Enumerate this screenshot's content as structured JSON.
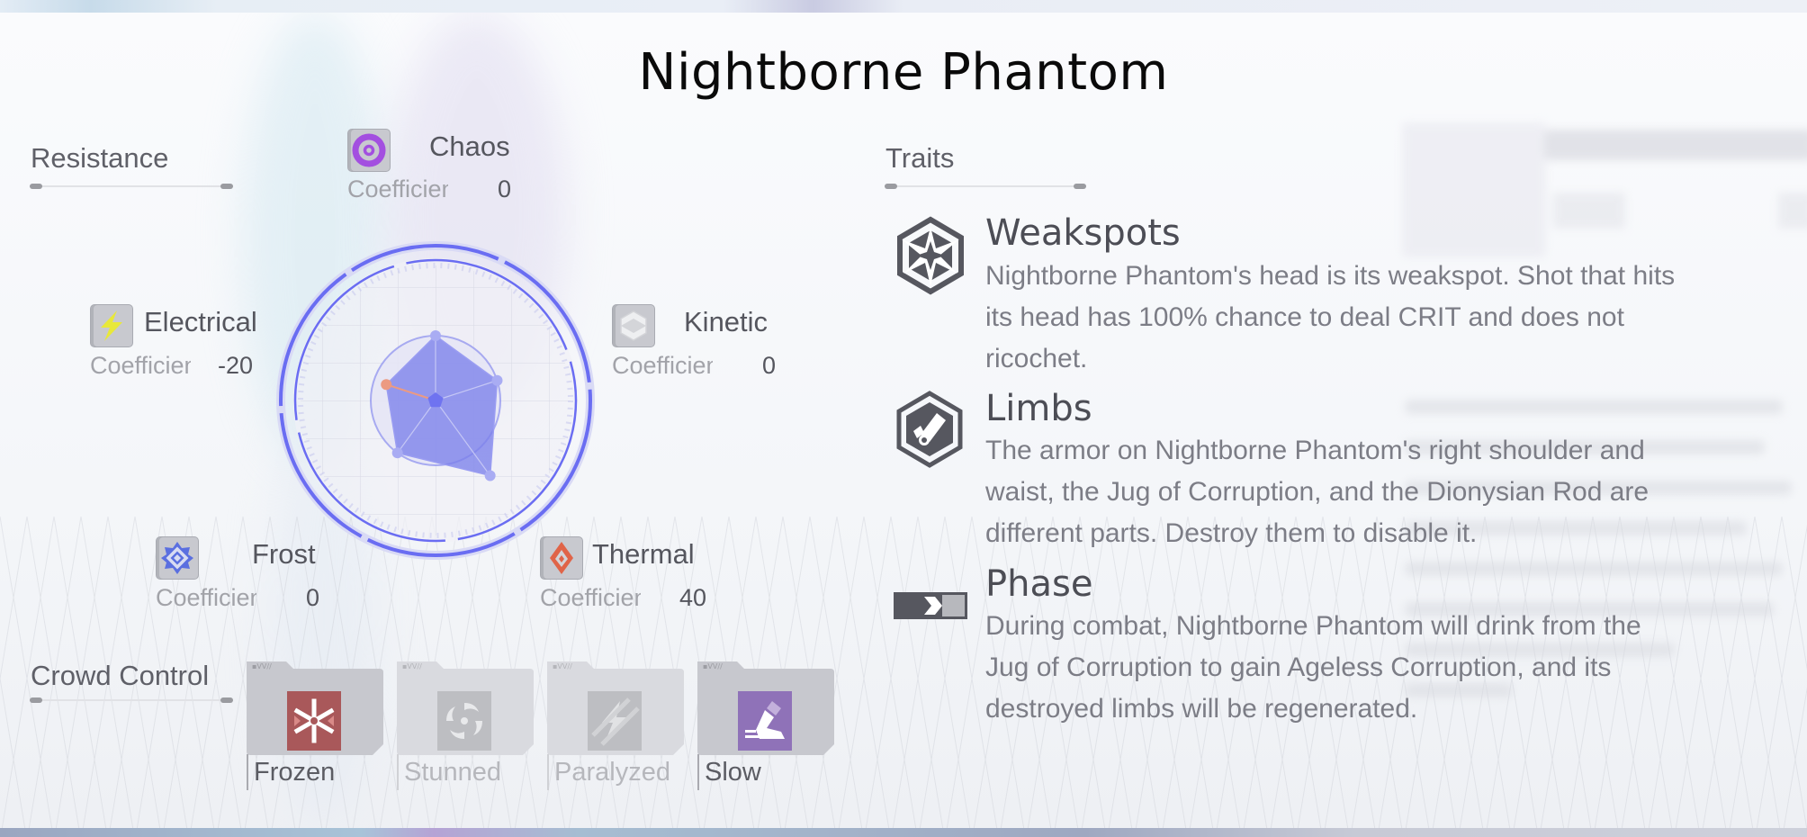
{
  "title": "Nightborne Phantom",
  "resistance": {
    "heading": "Resistance",
    "coefficient_label": "Coefficient",
    "elements": [
      {
        "name": "Chaos",
        "value": "0",
        "icon": "chaos-ring-icon",
        "color": "#a34fe0"
      },
      {
        "name": "Electrical",
        "value": "-20",
        "icon": "lightning-bolt-icon",
        "color": "#e8e83a"
      },
      {
        "name": "Kinetic",
        "value": "0",
        "icon": "kinetic-cube-icon",
        "color": "#e9eaec"
      },
      {
        "name": "Frost",
        "value": "0",
        "icon": "frost-star-icon",
        "color": "#5a6fe0"
      },
      {
        "name": "Thermal",
        "value": "40",
        "icon": "thermal-flame-icon",
        "color": "#e06448"
      }
    ],
    "radar": {
      "axes": [
        "Chaos",
        "Kinetic",
        "Thermal",
        "Frost",
        "Electrical"
      ],
      "values": [
        0,
        0,
        40,
        0,
        -20
      ],
      "range": [
        -100,
        100
      ],
      "fill_color": "#7b80ea",
      "ring_color": "#6a6df2",
      "negative_point_color": "#ec9a82"
    }
  },
  "traits": {
    "heading": "Traits",
    "items": [
      {
        "title": "Weakspots",
        "icon": "weakspot-star-hexagon-icon",
        "lines": [
          "Nightborne Phantom's head is its weakspot. Shot that hits",
          "its head has 100% chance to deal CRIT and does not",
          "ricochet."
        ]
      },
      {
        "title": "Limbs",
        "icon": "limbs-hexagon-icon",
        "lines": [
          "The armor on Nightborne Phantom's right shoulder and",
          "waist, the Jug of Corruption, and the Dionysian Rod are",
          "different parts. Destroy them to disable it."
        ]
      },
      {
        "title": "Phase",
        "icon": "phase-arrow-icon",
        "lines": [
          "During combat, Nightborne Phantom will drink from the",
          "Jug of Corruption to gain Ageless Corruption, and its",
          "destroyed limbs will be regenerated."
        ]
      }
    ]
  },
  "crowd_control": {
    "heading": "Crowd Control",
    "items": [
      {
        "label": "Frozen",
        "active": true,
        "icon": "frozen-snowflake-icon",
        "color": "#a9585a"
      },
      {
        "label": "Stunned",
        "active": false,
        "icon": "stunned-swirl-icon",
        "color": "#b8b9bd"
      },
      {
        "label": "Paralyzed",
        "active": false,
        "icon": "paralyzed-bolt-icon",
        "color": "#b8b9bd"
      },
      {
        "label": "Slow",
        "active": true,
        "icon": "slow-foot-icon",
        "color": "#8f72b8"
      }
    ]
  }
}
